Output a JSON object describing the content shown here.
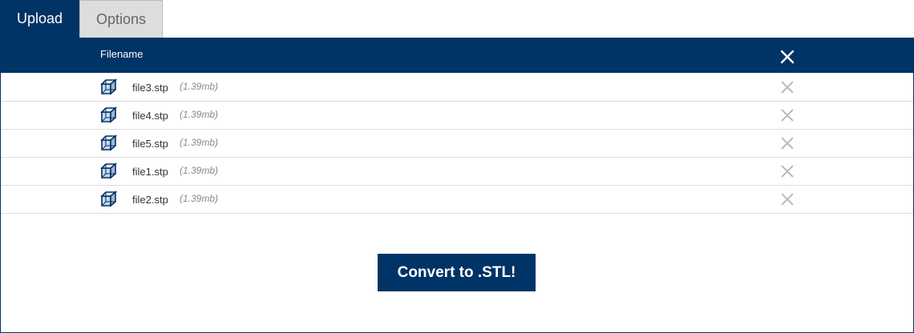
{
  "tabs": [
    {
      "label": "Upload",
      "active": true
    },
    {
      "label": "Options",
      "active": false
    }
  ],
  "table": {
    "header": "Filename",
    "close_icon": "close-icon"
  },
  "files": [
    {
      "name": "file3.stp",
      "size": "(1.39mb)"
    },
    {
      "name": "file4.stp",
      "size": "(1.39mb)"
    },
    {
      "name": "file5.stp",
      "size": "(1.39mb)"
    },
    {
      "name": "file1.stp",
      "size": "(1.39mb)"
    },
    {
      "name": "file2.stp",
      "size": "(1.39mb)"
    }
  ],
  "actions": {
    "convert_label": "Convert to .STL!"
  },
  "colors": {
    "brand": "#003366",
    "inactive_tab": "#dddddd",
    "remove_icon": "#bbbbbb"
  }
}
